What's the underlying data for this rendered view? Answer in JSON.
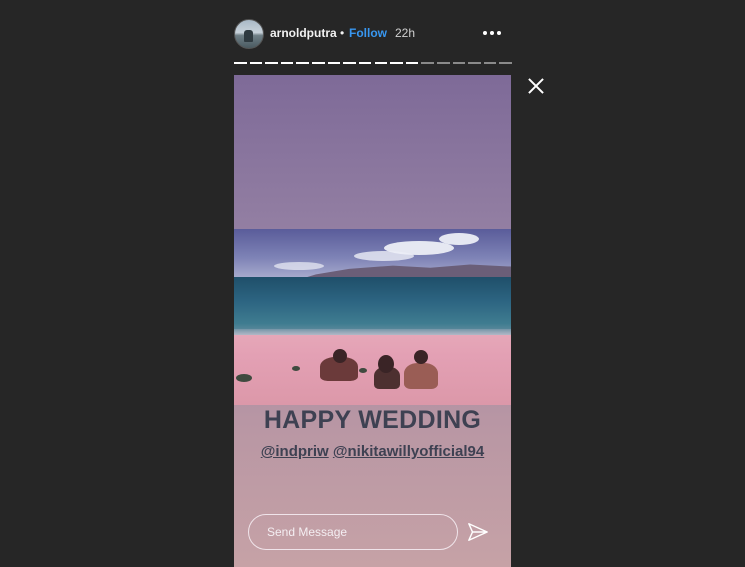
{
  "header": {
    "username": "arnoldputra",
    "separator": "•",
    "follow_label": "Follow",
    "timestamp": "22h"
  },
  "progress": {
    "segments_total": 18,
    "segments_viewed": 12,
    "viewed_color": "#ffffff",
    "unviewed_color": "#8a8a8a"
  },
  "story": {
    "headline": "HAPPY WEDDING",
    "mentions": [
      "@indpriw",
      "@nikitawillyofficial94"
    ]
  },
  "reply": {
    "placeholder": "Send Message"
  },
  "icons": {
    "more": "more-icon",
    "close": "close-icon",
    "send": "send-icon"
  },
  "colors": {
    "background": "#262626",
    "accent": "#3897f0",
    "story_text": "#3e4152"
  }
}
